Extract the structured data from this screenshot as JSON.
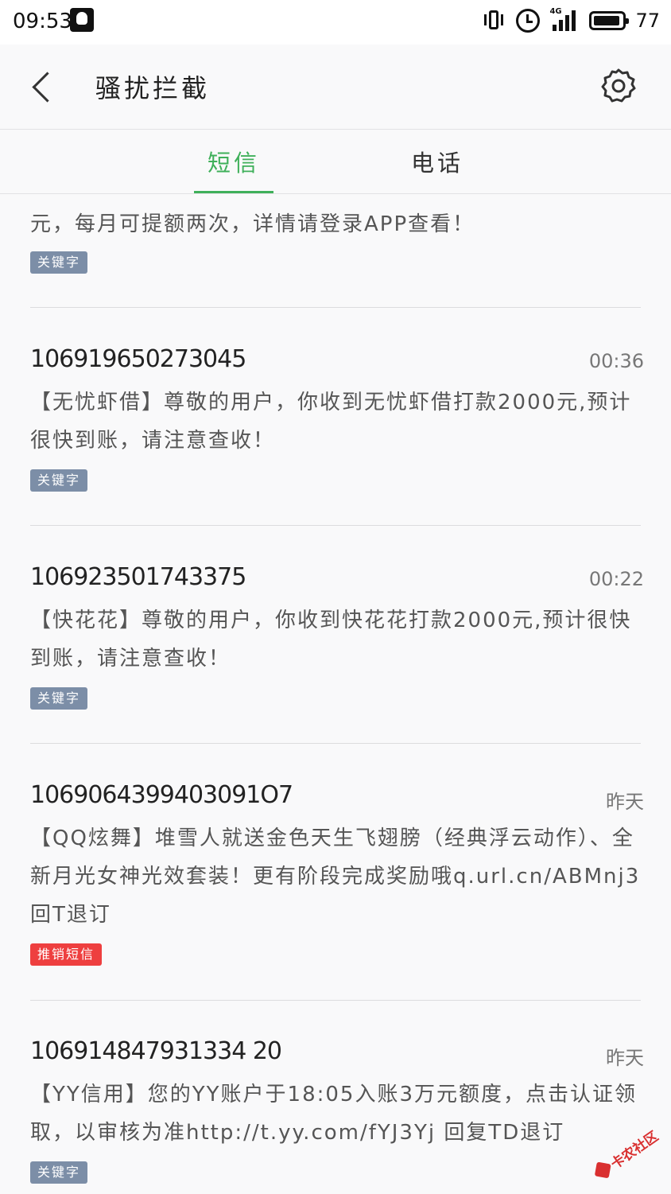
{
  "status_bar": {
    "time": "09:53",
    "network": "4G",
    "battery": "77",
    "icons": [
      "qq-icon",
      "vibrate-icon",
      "alarm-icon",
      "signal-icon",
      "battery-icon"
    ]
  },
  "header": {
    "title": "骚扰拦截",
    "back_icon": "chevron-left-icon",
    "settings_icon": "gear-icon"
  },
  "tabs": [
    {
      "label": "短信",
      "active": true
    },
    {
      "label": "电话",
      "active": false
    }
  ],
  "colors": {
    "accent": "#3fb05a",
    "tag_keyword": "#7c8ea7",
    "tag_promo": "#ee3f3f"
  },
  "messages": [
    {
      "partial": true,
      "text": "元，每月可提额两次，详情请登录APP查看！",
      "tag": "关键字"
    },
    {
      "sender": "106919650273045",
      "time": "00:36",
      "text": "【无忧虾借】尊敬的用户，你收到无忧虾借打款2000元,预计很快到账，请注意查收！",
      "tag": "关键字"
    },
    {
      "sender": "106923501743375",
      "time": "00:22",
      "text": "【快花花】尊敬的用户，你收到快花花打款2000元,预计很快到账，请注意查收！",
      "tag": "关键字"
    },
    {
      "sender": "1069064399403091O7",
      "time": "昨天",
      "text": "【QQ炫舞】堆雪人就送金色天生飞翅膀（经典浮云动作）、全新月光女神光效套装！更有阶段完成奖励哦q.url.cn/ABMnj3 回T退订",
      "tag": "推销短信"
    },
    {
      "sender": "106914847931334 20",
      "time": "昨天",
      "text": "【YY信用】您的YY账户于18:05入账3万元额度，点击认证领取，以审核为准http://t.yy.com/fYJ3Yj 回复TD退订",
      "tag": "关键字"
    }
  ],
  "watermark": "卡农社区"
}
